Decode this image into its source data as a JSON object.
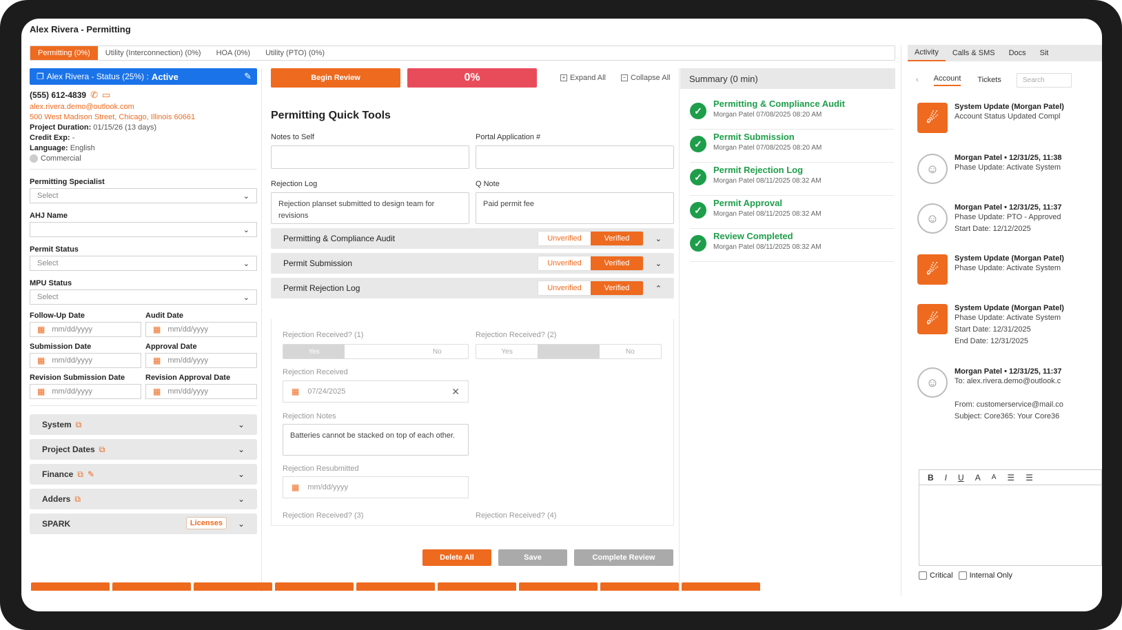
{
  "window": {
    "title": "Alex Rivera - Permitting"
  },
  "top_tabs": [
    {
      "label": "Permitting (0%)",
      "active": true
    },
    {
      "label": "Utility (Interconnection) (0%)",
      "active": false
    },
    {
      "label": "HOA (0%)",
      "active": false
    },
    {
      "label": "Utility (PTO) (0%)",
      "active": false
    }
  ],
  "left": {
    "status_prefix": "Alex Rivera - Status (25%) :",
    "status_value": "Active",
    "phone": "(555) 612-4839",
    "email": "alex.rivera.demo@outlook.com",
    "address": "500 West Madison Street, Chicago, Illinois 60661",
    "project_duration_label": "Project Duration:",
    "project_duration_value": "01/15/26 (13 days)",
    "credit_exp_label": "Credit Exp:",
    "credit_exp_value": "-",
    "language_label": "Language:",
    "language_value": "English",
    "commercial_label": "Commercial",
    "permitting_specialist_label": "Permitting Specialist",
    "permitting_specialist_value": "Select",
    "ahj_label": "AHJ Name",
    "ahj_value": "",
    "permit_status_label": "Permit Status",
    "permit_status_value": "Select",
    "mpu_label": "MPU Status",
    "mpu_value": "Select",
    "date_fields": [
      {
        "label": "Follow-Up Date",
        "placeholder": "mm/dd/yyyy"
      },
      {
        "label": "Audit Date",
        "placeholder": "mm/dd/yyyy"
      },
      {
        "label": "Submission Date",
        "placeholder": "mm/dd/yyyy"
      },
      {
        "label": "Approval Date",
        "placeholder": "mm/dd/yyyy"
      },
      {
        "label": "Revision Submission Date",
        "placeholder": "mm/dd/yyyy"
      },
      {
        "label": "Revision Approval Date",
        "placeholder": "mm/dd/yyyy"
      }
    ],
    "accordions": [
      {
        "label": "System"
      },
      {
        "label": "Project Dates"
      },
      {
        "label": "Finance"
      },
      {
        "label": "Adders"
      },
      {
        "label": "SPARK",
        "badge": "Licenses"
      }
    ]
  },
  "middle": {
    "begin_review": "Begin Review",
    "progress": "0%",
    "expand_all": "Expand All",
    "collapse_all": "Collapse All",
    "quick_tools_title": "Permitting Quick Tools",
    "notes_label": "Notes to Self",
    "portal_label": "Portal Application #",
    "rejection_log_label": "Rejection Log",
    "rejection_log_value": "Rejection planset submitted to design team for revisions",
    "qnote_label": "Q Note",
    "qnote_value": "Paid permit fee",
    "sections": [
      {
        "label": "Permitting & Compliance Audit",
        "unverified": "Unverified",
        "verified": "Verified"
      },
      {
        "label": "Permit Submission",
        "unverified": "Unverified",
        "verified": "Verified"
      },
      {
        "label": "Permit Rejection Log",
        "unverified": "Unverified",
        "verified": "Verified"
      }
    ],
    "rejection": {
      "received1": "Rejection Received? (1)",
      "received2": "Rejection Received? (2)",
      "yes": "Yes",
      "no": "No",
      "received_label": "Rejection Received",
      "received_date": "07/24/2025",
      "notes_label": "Rejection Notes",
      "notes_value": "Batteries cannot be stacked on top of each other.",
      "resubmitted_label": "Rejection Resubmitted",
      "resubmitted_placeholder": "mm/dd/yyyy",
      "received3": "Rejection Received? (3)",
      "received4": "Rejection Received? (4)"
    },
    "delete_all": "Delete All",
    "save": "Save",
    "complete_review": "Complete Review"
  },
  "summary": {
    "title": "Summary (0 min)",
    "items": [
      {
        "title": "Permitting & Compliance Audit",
        "meta": "Morgan Patel 07/08/2025 08:20 AM"
      },
      {
        "title": "Permit Submission",
        "meta": "Morgan Patel 07/08/2025 08:20 AM"
      },
      {
        "title": "Permit Rejection Log",
        "meta": "Morgan Patel 08/11/2025 08:32 AM"
      },
      {
        "title": "Permit Approval",
        "meta": "Morgan Patel 08/11/2025 08:32 AM"
      },
      {
        "title": "Review Completed",
        "meta": "Morgan Patel 08/11/2025 08:32 AM"
      }
    ]
  },
  "right": {
    "tabs": [
      "Activity",
      "Calls & SMS",
      "Docs",
      "Sit"
    ],
    "subtabs": [
      "Account",
      "Tickets"
    ],
    "search_placeholder": "Search",
    "activities": [
      {
        "type": "system",
        "head": "System Update (Morgan Patel)",
        "lines": [
          "Account Status Updated Compl"
        ]
      },
      {
        "type": "user",
        "head": "Morgan Patel • 12/31/25, 11:38",
        "lines": [
          "Phase Update: Activate System"
        ]
      },
      {
        "type": "user",
        "head": "Morgan Patel • 12/31/25, 11:37",
        "lines": [
          "Phase Update: PTO - Approved",
          "Start Date: 12/12/2025"
        ]
      },
      {
        "type": "system",
        "head": "System Update (Morgan Patel)",
        "lines": [
          "Phase Update: Activate System"
        ]
      },
      {
        "type": "system",
        "head": "System Update (Morgan Patel)",
        "lines": [
          "Phase Update: Activate System",
          "Start Date: 12/31/2025",
          "End Date: 12/31/2025"
        ]
      },
      {
        "type": "user",
        "head": "Morgan Patel • 12/31/25, 11:37",
        "lines": [
          "To: alex.rivera.demo@outlook.c",
          "",
          "From: customerservice@mail.co",
          "Subject: Core365: Your Core36"
        ]
      }
    ],
    "critical_label": "Critical",
    "internal_label": "Internal Only"
  },
  "colors": {
    "accent": "#ee6a1f",
    "status_blue": "#1a73e8",
    "success": "#1e9e4a",
    "progress_red": "#e84c5a"
  }
}
